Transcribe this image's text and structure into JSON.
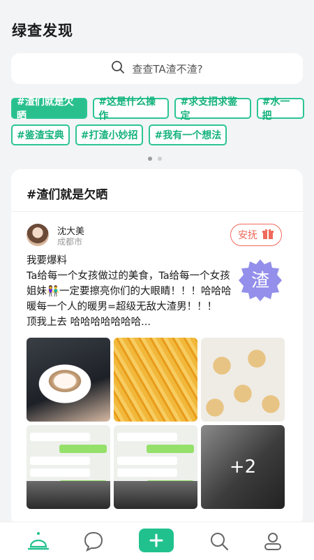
{
  "header": {
    "title": "绿查发现"
  },
  "search": {
    "placeholder": "查查TA渣不渣?"
  },
  "topics": {
    "row1": [
      "#渣们就是欠晒",
      "#这是什么操作",
      "#求支招求鉴定",
      "#水一把"
    ],
    "row2": [
      "#鉴渣宝典",
      "#打渣小妙招",
      "#我有一个想法"
    ],
    "active_index": 0
  },
  "pager": {
    "pages": 2,
    "current": 1
  },
  "card": {
    "title": "#渣们就是欠晒",
    "user": {
      "name": "沈大美",
      "city": "成都市"
    },
    "comfort_label": "安抚",
    "stamp_char": "渣",
    "lines": [
      "我要爆料",
      "Ta给每一个女孩做过的美食，Ta给每一个女孩",
      "姐妹👫一定要擦亮你们的大眼睛！！！哈哈哈",
      "暖每一个人的暖男=超级无敌大渣男！！！",
      "顶我上去 哈哈哈哈哈哈哈..."
    ],
    "more_count": "+2"
  },
  "tabbar": {
    "items": [
      "home-icon",
      "message-icon",
      "add-icon",
      "search-icon",
      "profile-icon"
    ],
    "accent": "#21c18e"
  }
}
